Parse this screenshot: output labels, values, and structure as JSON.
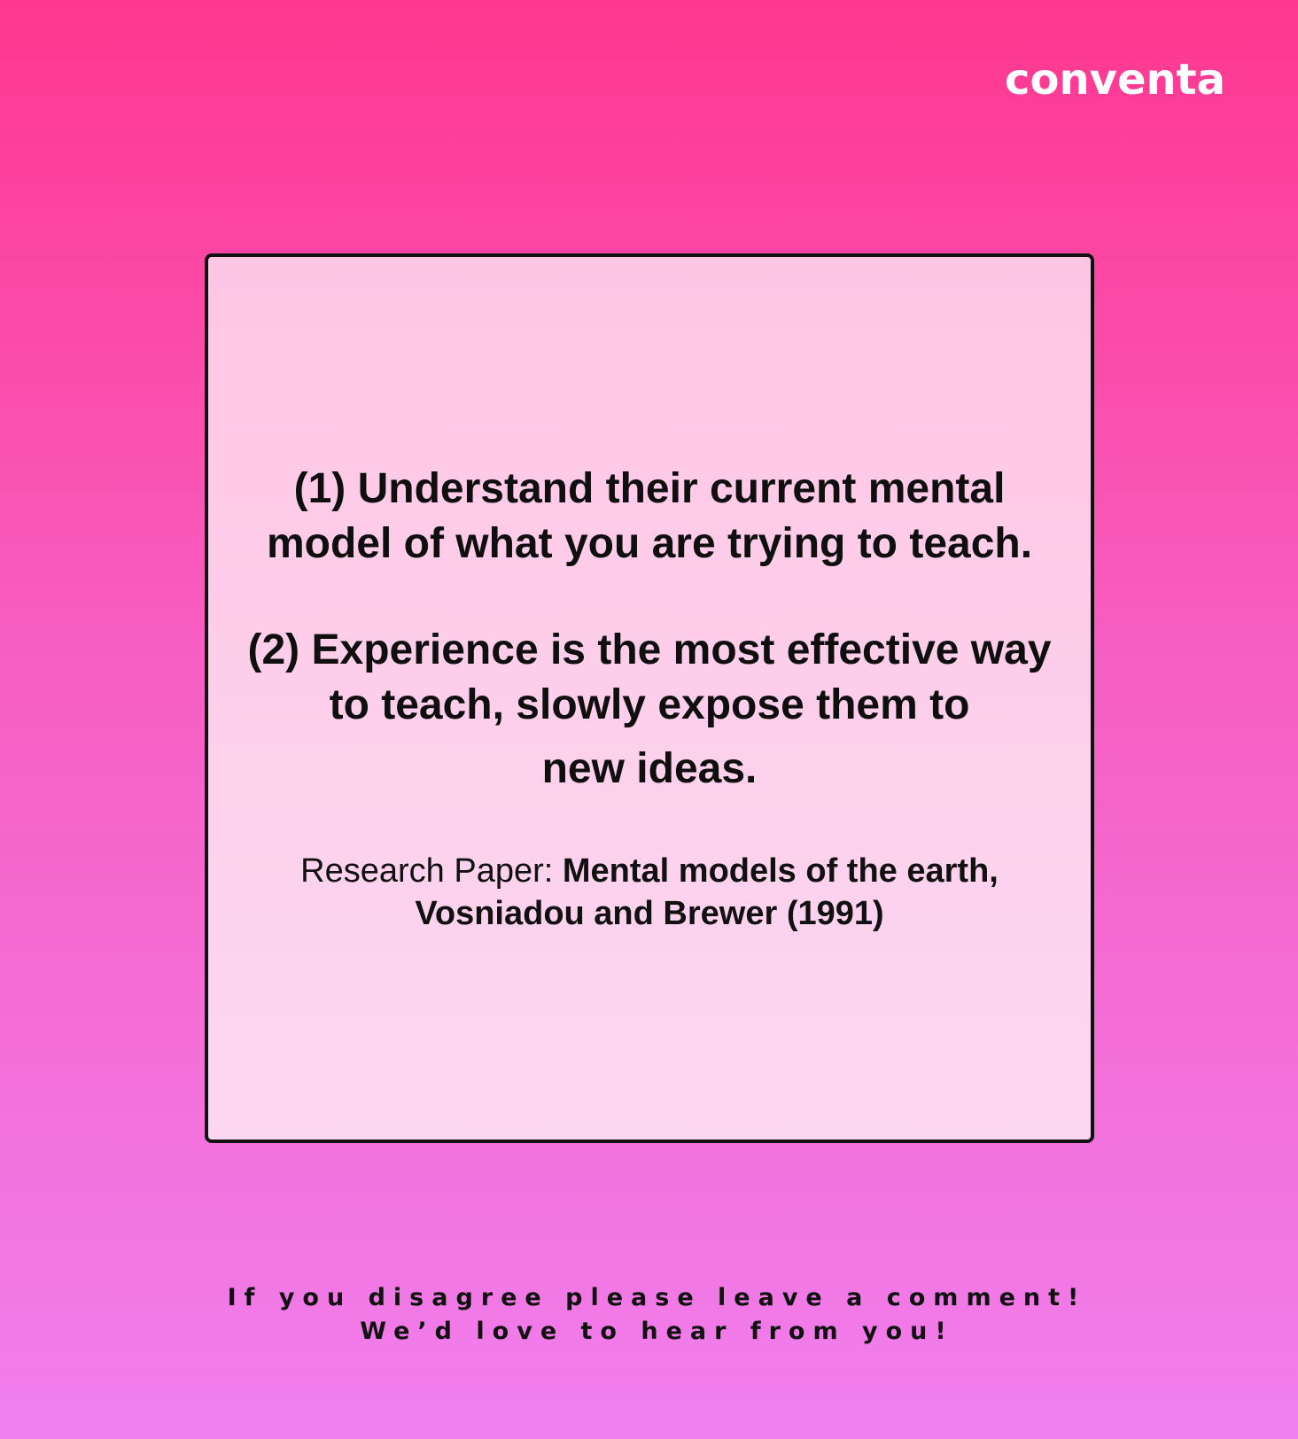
{
  "brand": {
    "logo_text": "conventa"
  },
  "card": {
    "point_1": "(1) Understand their current mental model of what you are trying to teach.",
    "point_2_main": "(2) Experience is the most effective way to teach, slowly expose them to",
    "point_2_end": "new ideas.",
    "citation_prefix": "Research Paper: ",
    "citation_title": "Mental models of the earth, Vosniadou and Brewer (1991)"
  },
  "footer": {
    "line_1": "If you disagree please leave a comment!",
    "line_2": "We’d love to hear from you!"
  },
  "colors": {
    "background_top": "#ff3790",
    "background_bottom": "#f07fee",
    "card_fill": "#fdd0ea",
    "card_border": "#111111",
    "logo": "#ffffff",
    "text": "#0f0f0f"
  }
}
